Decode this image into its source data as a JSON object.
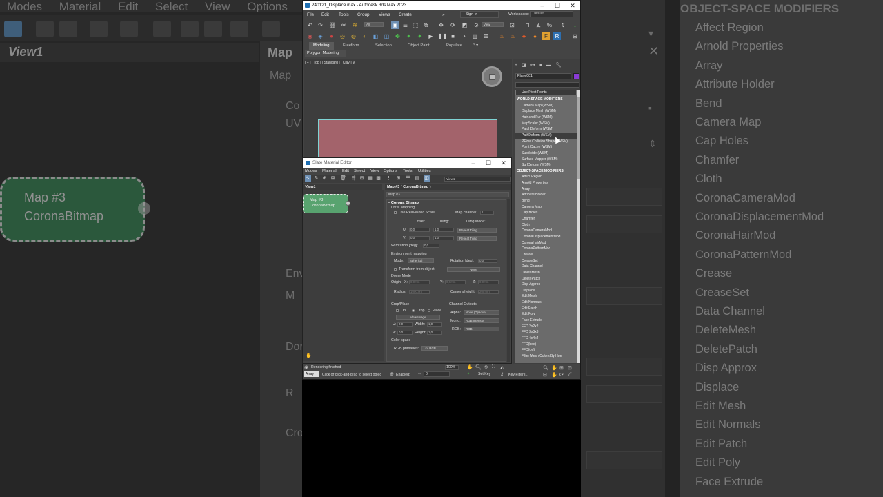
{
  "max_window": {
    "title": "240121_Displace.max - Autodesk 3ds Max 2023",
    "menu": [
      "File",
      "Edit",
      "Tools",
      "Group",
      "Views",
      "Create"
    ],
    "sign_in": "Sign In",
    "workspaces_label": "Workspaces:",
    "workspace_value": "Default",
    "selection_filter": "All",
    "view_dropdown": "View",
    "ribbon_tabs": [
      "Modeling",
      "Freeform",
      "Selection",
      "Object Paint",
      "Populate"
    ],
    "polygon_modeling": "Polygon Modeling",
    "viewport_label": "[ + ] [ Top ] [ Standard ] [ Clay ]",
    "viewport_colors": {
      "background": "#3d3d3d",
      "plane_fill": "#a3636b",
      "plane_edge": "#7fd4d4"
    }
  },
  "command_panel": {
    "object_name": "Plane001",
    "object_color": "#8a3bd6",
    "use_pivot_points": "Use Pivot Points",
    "world_space_header": "WORLD-SPACE MODIFIERS",
    "world_space": [
      "Camera Map (WSM)",
      "Displace Mesh (WSM)",
      "Hair and Fur (WSM)",
      "MapScaler (WSM)",
      "PatchDeform (WSM)",
      "PathDeform (WSM)",
      "PFlow Collision Shape (WSM)",
      "Point Cache (WSM)",
      "Subdivide (WSM)",
      "Surface Mapper (WSM)",
      "SurfDeform (WSM)"
    ],
    "selected_item": "PathDeform (WSM)",
    "object_space_header": "OBJECT-SPACE MODIFIERS",
    "object_space": [
      "Affect Region",
      "Arnold Properties",
      "Array",
      "Attribute Holder",
      "Bend",
      "Camera Map",
      "Cap Holes",
      "Chamfer",
      "Cloth",
      "CoronaCameraMod",
      "CoronaDisplacementMod",
      "CoronaHairMod",
      "CoronaPatternMod",
      "Crease",
      "CreaseSet",
      "Data Channel",
      "DeleteMesh",
      "DeletePatch",
      "Disp Approx",
      "Displace",
      "Edit Mesh",
      "Edit Normals",
      "Edit Patch",
      "Edit Poly",
      "Face Extrude",
      "FFD 2x2x2",
      "FFD 3x3x3",
      "FFD 4x4x4",
      "FFD(box)",
      "FFD(cyl)",
      "Filter Mesh Colors By Hue"
    ]
  },
  "slate": {
    "title": "Slate Material Editor",
    "menu": [
      "Modes",
      "Material",
      "Edit",
      "Select",
      "View",
      "Options",
      "Tools",
      "Utilities"
    ],
    "view_dropdown": "View1",
    "view_title": "View1",
    "node_line1": "Map #3",
    "node_line2": "CoronaBitmap",
    "node_color": "#58a36f",
    "panel_header": "Map #3  ( CoronaBitmap )",
    "map_name": "Map #3",
    "rollout_title": "Corona Bitmap",
    "uvw_mapping": "UVW Mapping",
    "use_real_world_scale": "Use Real-World Scale",
    "map_channel_label": "Map channel:",
    "map_channel_value": "1",
    "offset_label": "Offset:",
    "tiling_label": "Tiling:",
    "tiling_mode_label": "Tiling Mode:",
    "u_label": "U:",
    "v_label": "V:",
    "u_offset": "0,0",
    "v_offset": "0,0",
    "u_tiling": "1,0",
    "v_tiling": "1,0",
    "u_mode": "Repeat Tiling",
    "v_mode": "Repeat Tiling",
    "w_rotation_label": "W rotation [deg]:",
    "w_rotation_value": "0,0",
    "environment_mapping": "Environment mapping",
    "mode_label": "Mode:",
    "mode_value": "Spherical",
    "rotation_label": "Rotation [deg]:",
    "rotation_value": "0,0",
    "transform_from_object": "Transform from object:",
    "none_button": "None",
    "dome_mode": "Dome Mode",
    "origin_label": "Origin",
    "x_label": "X:",
    "y_label": "Y:",
    "z_label": "Z:",
    "origin_x": "0,0mm",
    "origin_y": "0,0mm",
    "origin_z": "0,0mm",
    "radius_label": "Radius:",
    "radius_value": "1000,0m",
    "camera_height_label": "Camera height:",
    "camera_height_value": "200,0m",
    "crop_place": "Crop/Place",
    "on_label": "On",
    "crop_label": "Crop",
    "place_label": "Place",
    "view_image": "View Image",
    "width_label": "Width:",
    "height_label": "Height:",
    "crop_u": "0,0",
    "crop_v": "0,0",
    "crop_width": "1,0",
    "crop_height": "1,0",
    "channel_outputs": "Channel Outputs",
    "alpha_label": "Alpha:",
    "alpha_value": "None (Opaque)",
    "mono_label": "Mono:",
    "mono_value": "RGB Intensity",
    "rgb_label": "RGB:",
    "rgb_value": "RGB",
    "color_space": "Color space",
    "rgb_primaries_label": "RGB primaries:",
    "rgb_primaries_value": "Lin. RGB"
  },
  "status": {
    "rendering": "Rendering finished",
    "maxscript": "Array",
    "prompt": "Click or click-and-drag to select objec",
    "enabled": "Enabled:",
    "frame": "0",
    "zoom": "100%",
    "set_key": "Set Key",
    "key_filters": "Key Filters..."
  },
  "background_left": {
    "menu": [
      "Modes",
      "Material",
      "Edit",
      "Select",
      "View",
      "Options"
    ],
    "view_title": "View1",
    "node_line1": "Map #3",
    "node_line2": "CoronaBitmap",
    "panel_title": "Map",
    "panel_sub": "Map",
    "side_labels": [
      "Co",
      "UV",
      "Env",
      "M",
      "Dor",
      "R",
      "Cro"
    ]
  },
  "background_right": {
    "header": "OBJECT-SPACE MODIFIERS",
    "items": [
      "Affect Region",
      "Arnold Properties",
      "Array",
      "Attribute Holder",
      "Bend",
      "Camera Map",
      "Cap Holes",
      "Chamfer",
      "Cloth",
      "CoronaCameraMod",
      "CoronaDisplacementMod",
      "CoronaHairMod",
      "CoronaPatternMod",
      "Crease",
      "CreaseSet",
      "Data Channel",
      "DeleteMesh",
      "DeletePatch",
      "Disp Approx",
      "Displace",
      "Edit Mesh",
      "Edit Normals",
      "Edit Patch",
      "Edit Poly",
      "Face Extrude"
    ]
  }
}
